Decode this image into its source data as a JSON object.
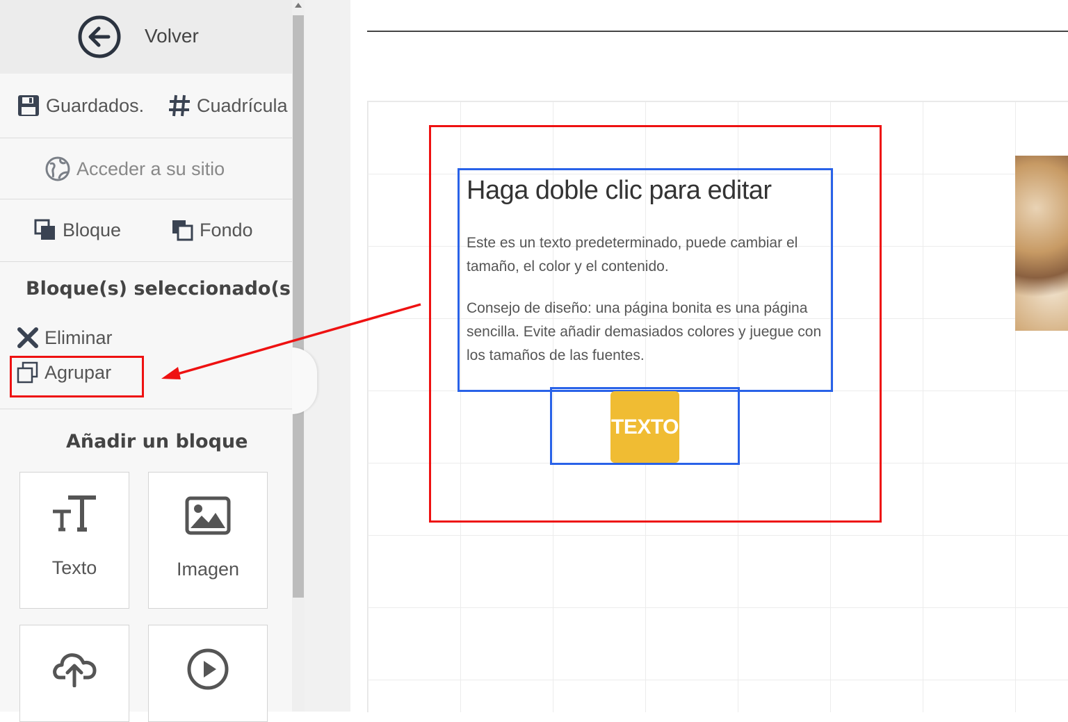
{
  "sidebar": {
    "back_label": "Volver",
    "saved_label": "Guardados.",
    "grid_label": "Cuadrícula",
    "site_access_label": "Acceder a su sitio",
    "block_label": "Bloque",
    "background_label": "Fondo",
    "selected_title": "Bloque(s) seleccionado(s)",
    "delete_label": "Eliminar",
    "group_label": "Agrupar",
    "add_block_title": "Añadir un bloque",
    "tiles": [
      {
        "label": "Texto",
        "icon": "text-size-icon"
      },
      {
        "label": "Imagen",
        "icon": "image-icon"
      },
      {
        "label": "",
        "icon": "upload-cloud-icon"
      },
      {
        "label": "",
        "icon": "play-circle-icon"
      }
    ]
  },
  "canvas": {
    "heading": "Haga doble clic para editar",
    "paragraph_1": "Este es un texto predeterminado, puede cambiar el tamaño, el color y el contenido.",
    "paragraph_2": "Consejo de diseño: una página bonita es una página sencilla. Evite añadir demasiados colores y juegue con los tamaños de las fuentes.",
    "button_label": "TEXTO"
  },
  "colors": {
    "selection_blue": "#2962e8",
    "annotation_red": "#e11111",
    "button_yellow": "#f0bc33"
  }
}
